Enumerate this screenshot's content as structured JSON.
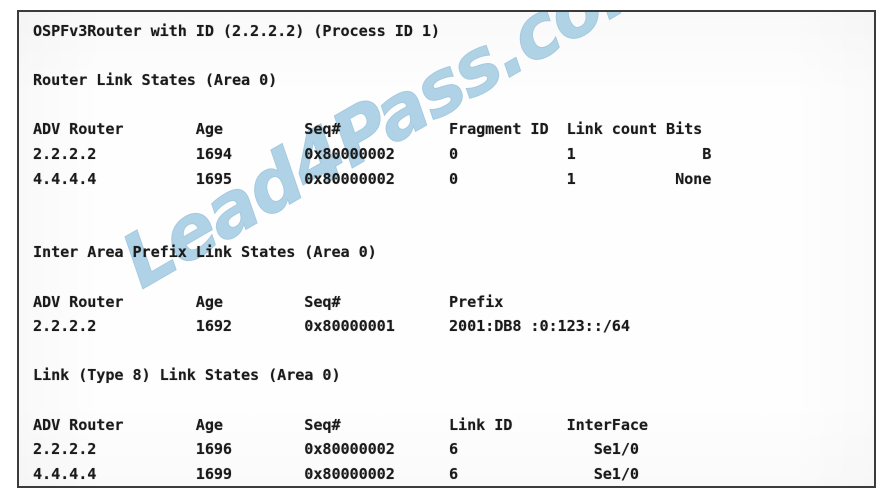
{
  "document": {
    "title_line": "OSPFv3Router with ID (2.2.2.2) (Process ID 1)",
    "watermark": "Lead4Pass.com",
    "watermark_color": "#a9cfe4",
    "text_color": "#1a1a1a",
    "border_color": "#3b3b3b",
    "background_color": "#fefefe"
  },
  "sections": [
    {
      "heading": "Router Link States (Area 0)",
      "columns": [
        "ADV Router",
        "Age",
        "Seq#",
        "Fragment ID",
        "Link count",
        "Bits"
      ],
      "header_line": "ADV Router        Age         Seq#            Fragment ID  Link count Bits",
      "rows": [
        {
          "line": "2.2.2.2           1694        0x80000002      0            1              B",
          "adv_router": "2.2.2.2",
          "age": "1694",
          "seq": "0x80000002",
          "fragment_id": "0",
          "link_count": "1",
          "bits": "B"
        },
        {
          "line": "4.4.4.4           1695        0x80000002      0            1           None",
          "adv_router": "4.4.4.4",
          "age": "1695",
          "seq": "0x80000002",
          "fragment_id": "0",
          "link_count": "1",
          "bits": "None"
        }
      ]
    },
    {
      "heading": "Inter Area Prefix Link States (Area 0)",
      "columns": [
        "ADV Router",
        "Age",
        "Seq#",
        "Prefix"
      ],
      "header_line": "ADV Router        Age         Seq#            Prefix",
      "rows": [
        {
          "line": "2.2.2.2           1692        0x80000001      2001:DB8 :0:123::/64",
          "adv_router": "2.2.2.2",
          "age": "1692",
          "seq": "0x80000001",
          "prefix": "2001:DB8 :0:123::/64"
        }
      ]
    },
    {
      "heading": "Link (Type 8) Link States (Area 0)",
      "columns": [
        "ADV Router",
        "Age",
        "Seq#",
        "Link ID",
        "InterFace"
      ],
      "header_line": "ADV Router        Age         Seq#            Link ID      InterFace",
      "rows": [
        {
          "line": "2.2.2.2           1696        0x80000002      6               Se1/0",
          "adv_router": "2.2.2.2",
          "age": "1696",
          "seq": "0x80000002",
          "link_id": "6",
          "interface": "Se1/0"
        },
        {
          "line": "4.4.4.4           1699        0x80000002      6               Se1/0",
          "adv_router": "4.4.4.4",
          "age": "1699",
          "seq": "0x80000002",
          "link_id": "6",
          "interface": "Se1/0"
        }
      ]
    }
  ],
  "lines": [
    "OSPFv3Router with ID (2.2.2.2) (Process ID 1)",
    "",
    "Router Link States (Area 0)",
    "",
    "ADV Router        Age         Seq#            Fragment ID  Link count Bits",
    "2.2.2.2           1694        0x80000002      0            1              B",
    "4.4.4.4           1695        0x80000002      0            1           None",
    "",
    "",
    "Inter Area Prefix Link States (Area 0)",
    "",
    "ADV Router        Age         Seq#            Prefix",
    "2.2.2.2           1692        0x80000001      2001:DB8 :0:123::/64",
    "",
    "Link (Type 8) Link States (Area 0)",
    "",
    "ADV Router        Age         Seq#            Link ID      InterFace",
    "2.2.2.2           1696        0x80000002      6               Se1/0",
    "4.4.4.4           1699        0x80000002      6               Se1/0"
  ]
}
